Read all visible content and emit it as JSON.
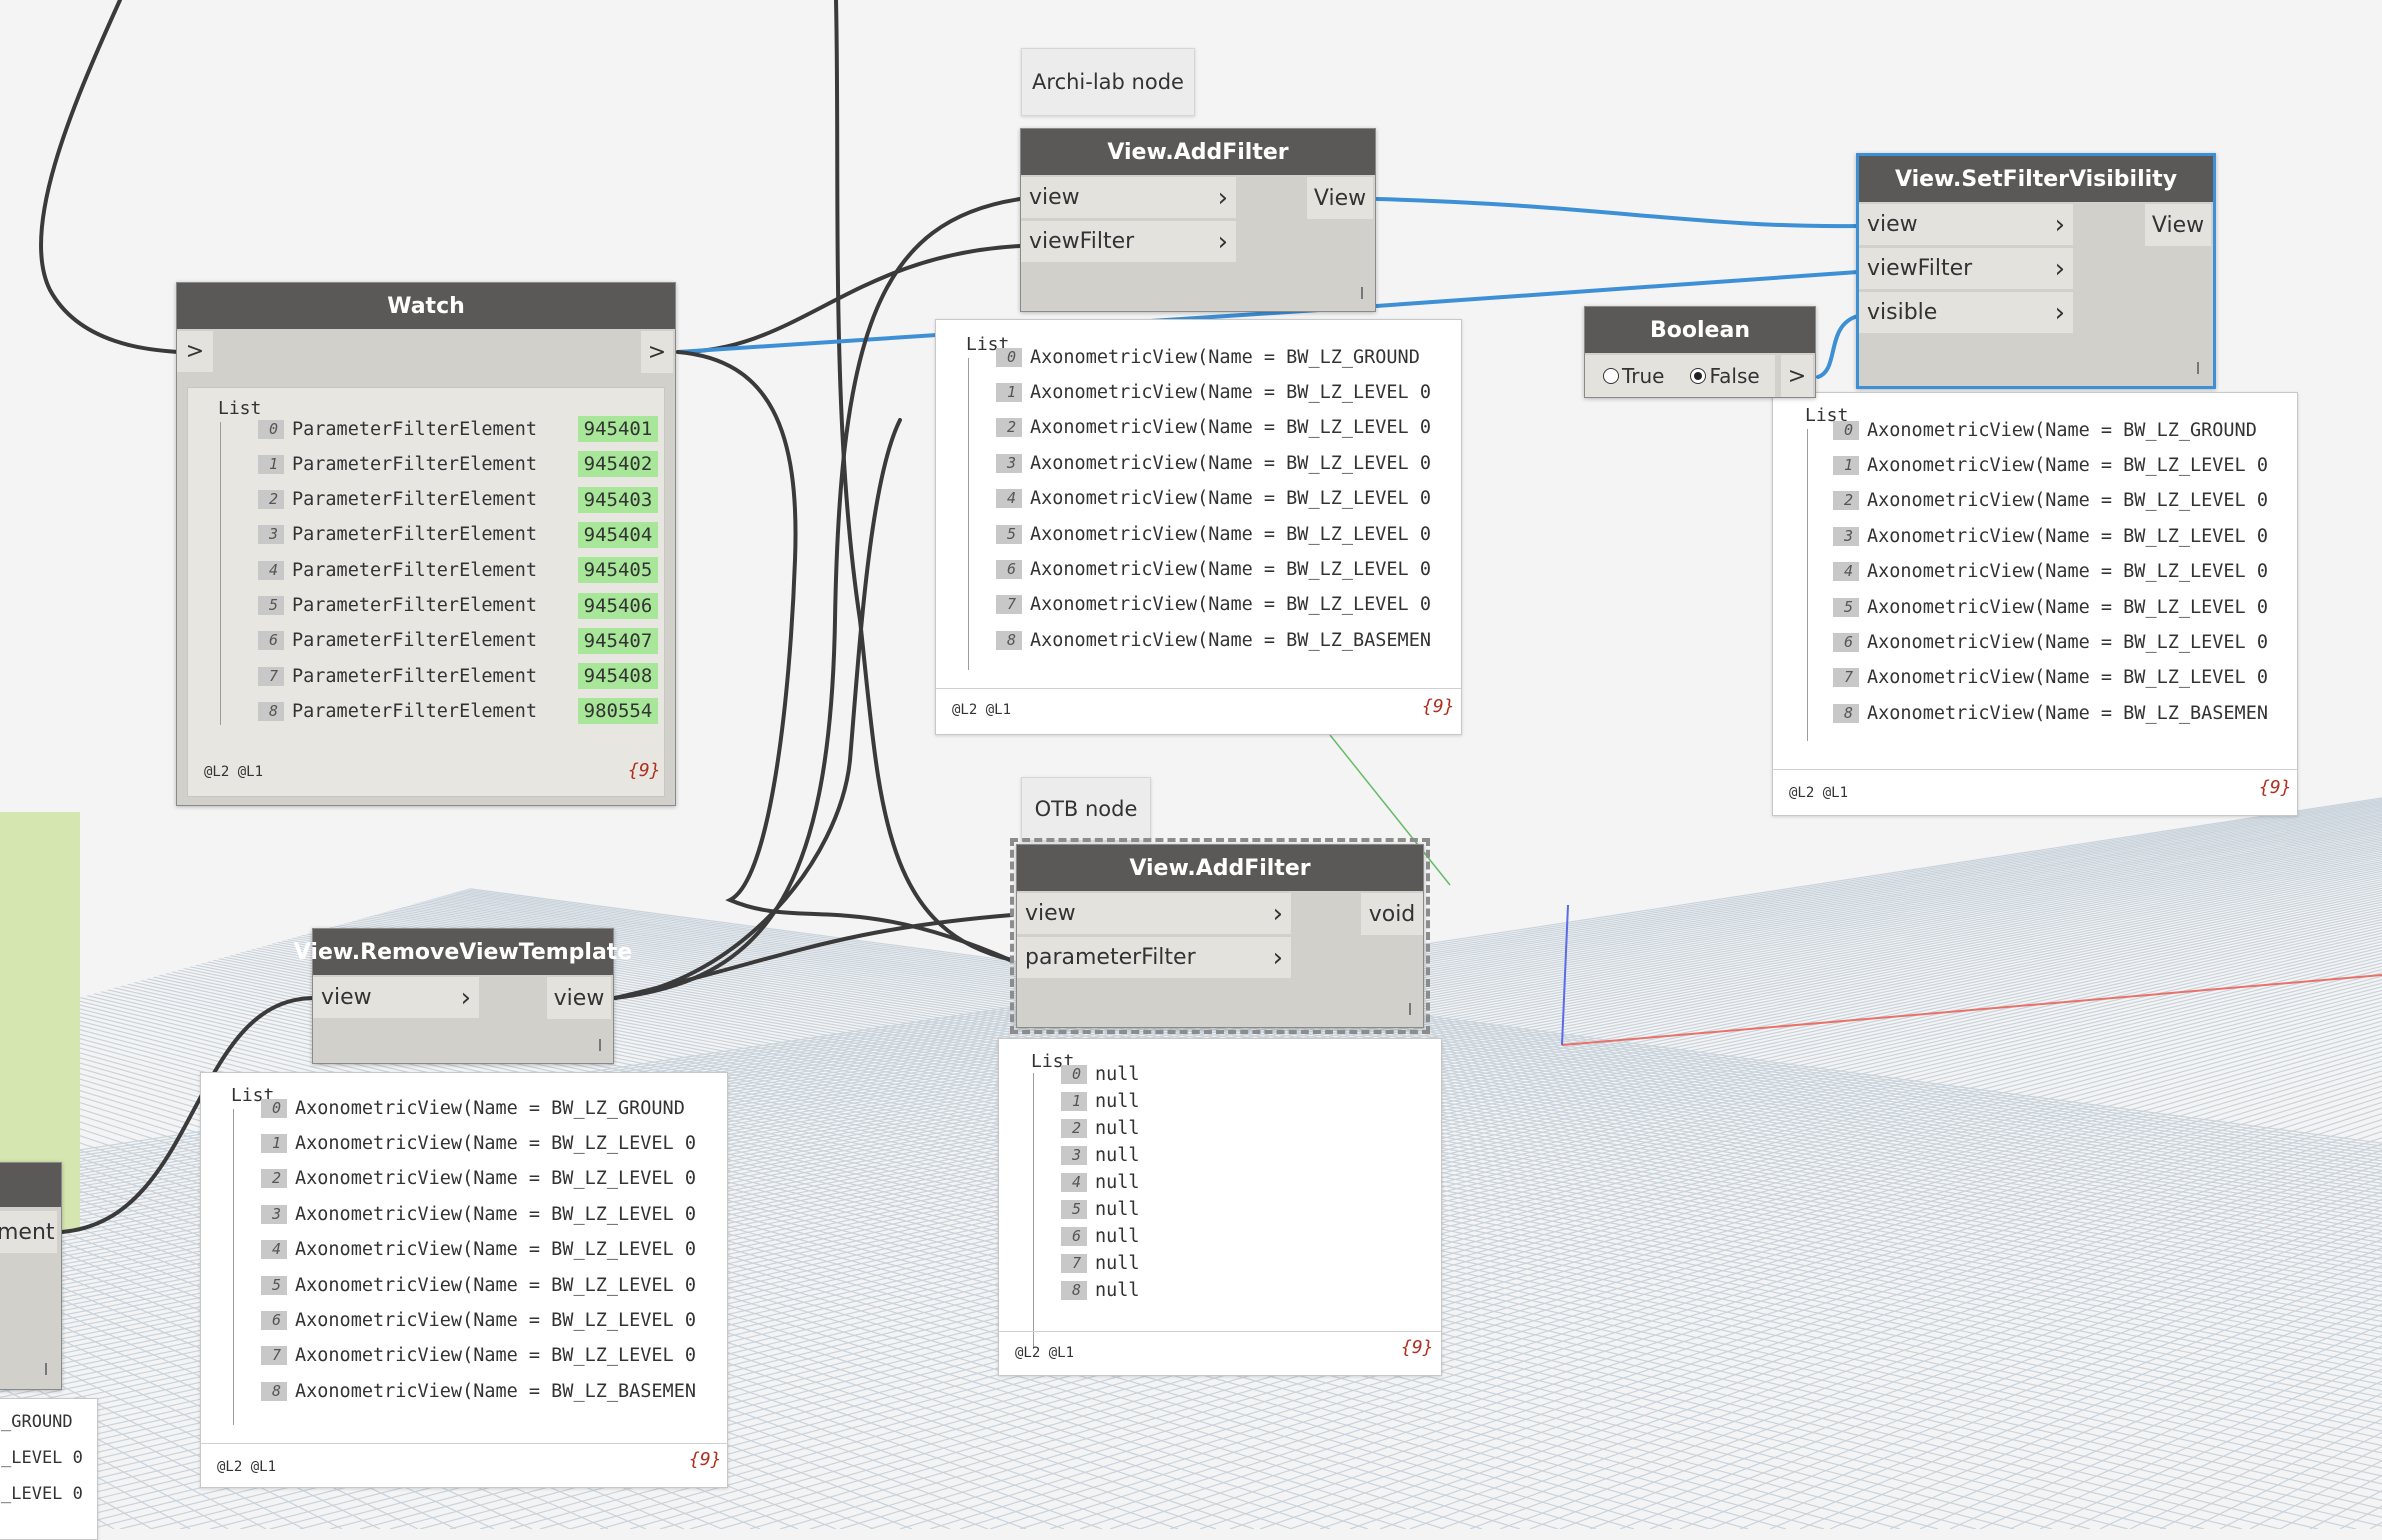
{
  "notes": {
    "archi_lab": "Archi-lab node",
    "otb": "OTB node"
  },
  "watch_node": {
    "title": "Watch",
    "input_port": ">",
    "output_port": ">",
    "list_label": "List",
    "items": [
      {
        "index": "0",
        "text": "ParameterFilterElement",
        "id": "945401"
      },
      {
        "index": "1",
        "text": "ParameterFilterElement",
        "id": "945402"
      },
      {
        "index": "2",
        "text": "ParameterFilterElement",
        "id": "945403"
      },
      {
        "index": "3",
        "text": "ParameterFilterElement",
        "id": "945404"
      },
      {
        "index": "4",
        "text": "ParameterFilterElement",
        "id": "945405"
      },
      {
        "index": "5",
        "text": "ParameterFilterElement",
        "id": "945406"
      },
      {
        "index": "6",
        "text": "ParameterFilterElement",
        "id": "945407"
      },
      {
        "index": "7",
        "text": "ParameterFilterElement",
        "id": "945408"
      },
      {
        "index": "8",
        "text": "ParameterFilterElement",
        "id": "980554"
      }
    ],
    "levels": "@L2 @L1",
    "count": "{9}"
  },
  "addfilter_archilab": {
    "title": "View.AddFilter",
    "inputs": [
      "view",
      "viewFilter"
    ],
    "output": "View"
  },
  "addfilter_archilab_preview": {
    "list_label": "List",
    "items": [
      {
        "index": "0",
        "text": "AxonometricView(Name = BW_LZ_GROUND"
      },
      {
        "index": "1",
        "text": "AxonometricView(Name = BW_LZ_LEVEL 0"
      },
      {
        "index": "2",
        "text": "AxonometricView(Name = BW_LZ_LEVEL 0"
      },
      {
        "index": "3",
        "text": "AxonometricView(Name = BW_LZ_LEVEL 0"
      },
      {
        "index": "4",
        "text": "AxonometricView(Name = BW_LZ_LEVEL 0"
      },
      {
        "index": "5",
        "text": "AxonometricView(Name = BW_LZ_LEVEL 0"
      },
      {
        "index": "6",
        "text": "AxonometricView(Name = BW_LZ_LEVEL 0"
      },
      {
        "index": "7",
        "text": "AxonometricView(Name = BW_LZ_LEVEL 0"
      },
      {
        "index": "8",
        "text": "AxonometricView(Name = BW_LZ_BASEMEN"
      }
    ],
    "levels": "@L2 @L1",
    "count": "{9}"
  },
  "setfiltervisibility": {
    "title": "View.SetFilterVisibility",
    "inputs": [
      "view",
      "viewFilter",
      "visible"
    ],
    "output": "View"
  },
  "setfiltervisibility_preview": {
    "list_label": "List",
    "items": [
      {
        "index": "0",
        "text": "AxonometricView(Name = BW_LZ_GROUND"
      },
      {
        "index": "1",
        "text": "AxonometricView(Name = BW_LZ_LEVEL 0"
      },
      {
        "index": "2",
        "text": "AxonometricView(Name = BW_LZ_LEVEL 0"
      },
      {
        "index": "3",
        "text": "AxonometricView(Name = BW_LZ_LEVEL 0"
      },
      {
        "index": "4",
        "text": "AxonometricView(Name = BW_LZ_LEVEL 0"
      },
      {
        "index": "5",
        "text": "AxonometricView(Name = BW_LZ_LEVEL 0"
      },
      {
        "index": "6",
        "text": "AxonometricView(Name = BW_LZ_LEVEL 0"
      },
      {
        "index": "7",
        "text": "AxonometricView(Name = BW_LZ_LEVEL 0"
      },
      {
        "index": "8",
        "text": "AxonometricView(Name = BW_LZ_BASEMEN"
      }
    ],
    "levels": "@L2 @L1",
    "count": "{9}"
  },
  "boolean_node": {
    "title": "Boolean",
    "true_label": "True",
    "false_label": "False",
    "selected": "False",
    "output_port": ">"
  },
  "addfilter_otb": {
    "title": "View.AddFilter",
    "inputs": [
      "view",
      "parameterFilter"
    ],
    "output": "void"
  },
  "addfilter_otb_preview": {
    "list_label": "List",
    "items": [
      {
        "index": "0",
        "text": "null"
      },
      {
        "index": "1",
        "text": "null"
      },
      {
        "index": "2",
        "text": "null"
      },
      {
        "index": "3",
        "text": "null"
      },
      {
        "index": "4",
        "text": "null"
      },
      {
        "index": "5",
        "text": "null"
      },
      {
        "index": "6",
        "text": "null"
      },
      {
        "index": "7",
        "text": "null"
      },
      {
        "index": "8",
        "text": "null"
      }
    ],
    "levels": "@L2 @L1",
    "count": "{9}"
  },
  "removeviewtemplate": {
    "title": "View.RemoveViewTemplate",
    "input": "view",
    "output": "view"
  },
  "removeviewtemplate_preview": {
    "list_label": "List",
    "items": [
      {
        "index": "0",
        "text": "AxonometricView(Name = BW_LZ_GROUND"
      },
      {
        "index": "1",
        "text": "AxonometricView(Name = BW_LZ_LEVEL 0"
      },
      {
        "index": "2",
        "text": "AxonometricView(Name = BW_LZ_LEVEL 0"
      },
      {
        "index": "3",
        "text": "AxonometricView(Name = BW_LZ_LEVEL 0"
      },
      {
        "index": "4",
        "text": "AxonometricView(Name = BW_LZ_LEVEL 0"
      },
      {
        "index": "5",
        "text": "AxonometricView(Name = BW_LZ_LEVEL 0"
      },
      {
        "index": "6",
        "text": "AxonometricView(Name = BW_LZ_LEVEL 0"
      },
      {
        "index": "7",
        "text": "AxonometricView(Name = BW_LZ_LEVEL 0"
      },
      {
        "index": "8",
        "text": "AxonometricView(Name = BW_LZ_BASEMEN"
      }
    ],
    "levels": "@L2 @L1",
    "count": "{9}"
  },
  "partial_node": {
    "output_label": "ment"
  },
  "partial_preview": {
    "lines": [
      "_GROUND",
      "_LEVEL 0",
      "_LEVEL 0"
    ]
  },
  "colors": {
    "canvas_bg": "#f4f4f4",
    "grid_line": "#c9d3dc",
    "wire_dark": "#3a3a3a",
    "wire_blue": "#3d8fd6",
    "node_header": "#5b5958",
    "node_body": "#d2d0cb",
    "id_highlight": "#a8e69a",
    "group_bg": "#d6e6b0"
  }
}
